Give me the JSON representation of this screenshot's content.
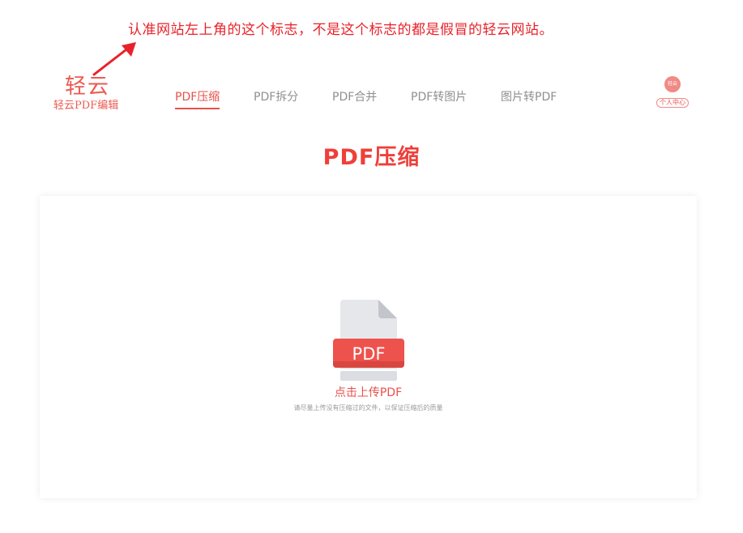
{
  "annotation": {
    "text": "认准网站左上角的这个标志，不是这个标志的都是假冒的轻云网站。"
  },
  "logo": {
    "main": "轻云",
    "sub": "轻云PDF编辑"
  },
  "nav": {
    "items": [
      {
        "label": "PDF压缩",
        "active": true
      },
      {
        "label": "PDF拆分",
        "active": false
      },
      {
        "label": "PDF合并",
        "active": false
      },
      {
        "label": "PDF转图片",
        "active": false
      },
      {
        "label": "图片转PDF",
        "active": false
      }
    ]
  },
  "user": {
    "avatar_text": "轻云",
    "label": "个人中心"
  },
  "page": {
    "title": "PDF压缩"
  },
  "upload": {
    "icon_text": "PDF",
    "label": "点击上传PDF",
    "hint": "请尽量上传没有压缩过的文件，以保证压缩后的质量"
  },
  "colors": {
    "accent": "#e8504a",
    "annotation": "#e8222a",
    "title": "#ef3f3a"
  }
}
